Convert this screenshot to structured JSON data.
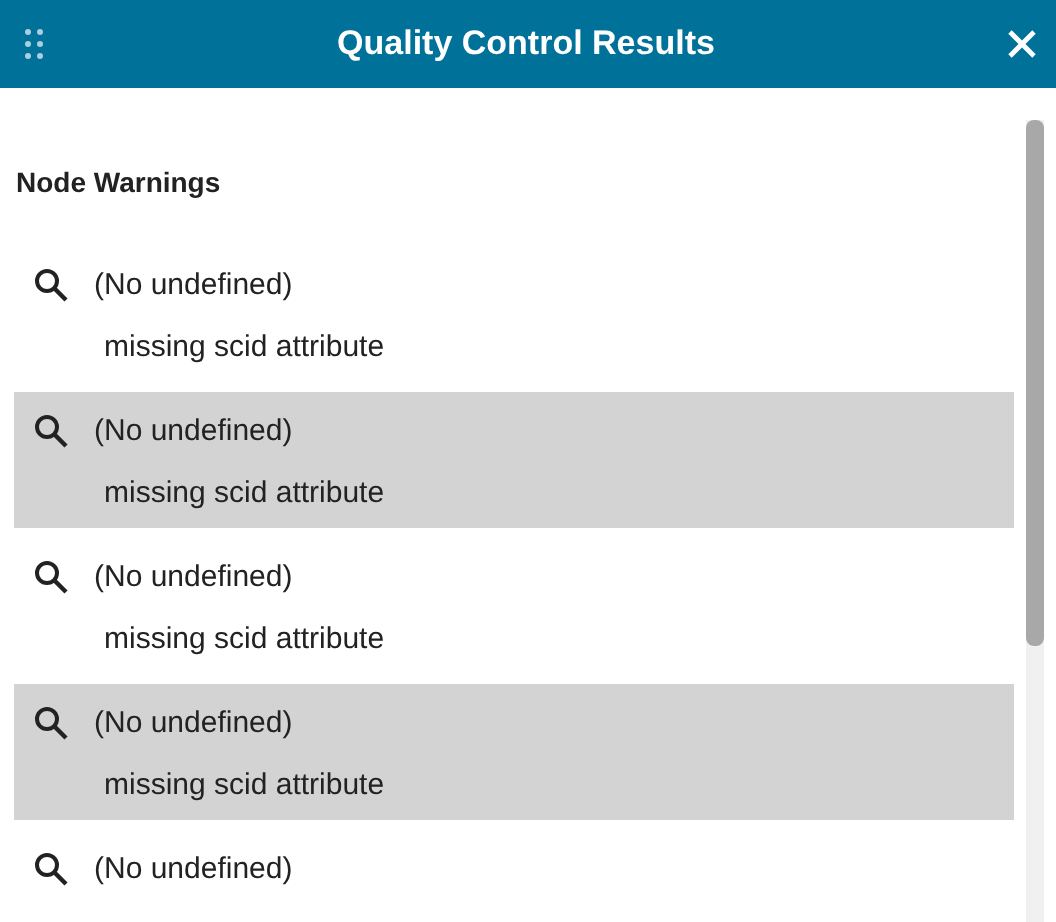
{
  "window": {
    "title": "Quality Control Results"
  },
  "section": {
    "heading": "Node Warnings"
  },
  "warnings": [
    {
      "title": "(No undefined)",
      "detail": "missing scid attribute",
      "shaded": false
    },
    {
      "title": "(No undefined)",
      "detail": "missing scid attribute",
      "shaded": true
    },
    {
      "title": "(No undefined)",
      "detail": "missing scid attribute",
      "shaded": false
    },
    {
      "title": "(No undefined)",
      "detail": "missing scid attribute",
      "shaded": true
    },
    {
      "title": "(No undefined)",
      "shaded": false
    }
  ]
}
